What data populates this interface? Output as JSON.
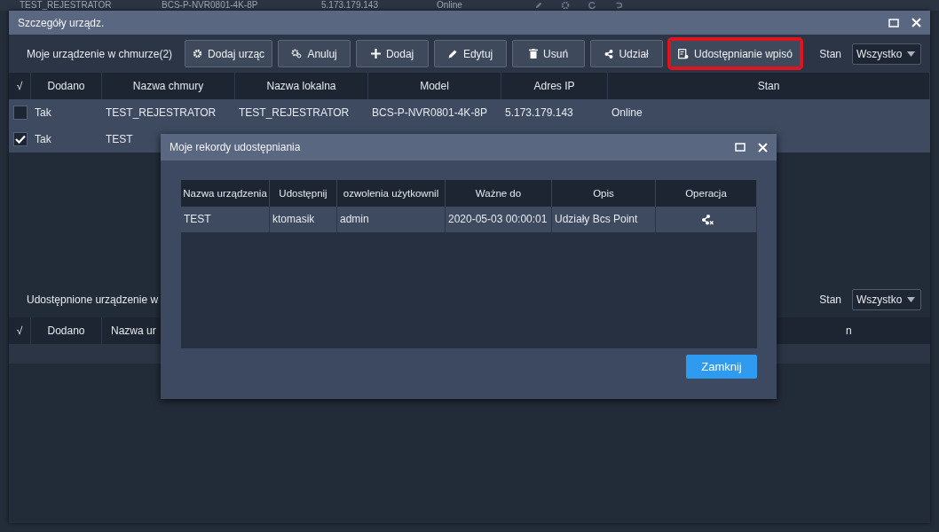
{
  "background_row": {
    "cells": [
      "TEST_REJESTRATOR",
      "BCS-P-NVR0801-4K-8P",
      "5.173.179.143",
      "Online"
    ]
  },
  "window": {
    "title": "Szczegóły urządz."
  },
  "cloud_section": {
    "label": "Moje urządzenie w chmurze(2)",
    "buttons": [
      {
        "label": "Dodaj urząc",
        "kind": "gear",
        "highlighted": false
      },
      {
        "label": "Anuluj",
        "kind": "gears",
        "highlighted": false
      },
      {
        "label": "Dodaj",
        "kind": "plus",
        "highlighted": false
      },
      {
        "label": "Edytuj",
        "kind": "pencil",
        "highlighted": false
      },
      {
        "label": "Usuń",
        "kind": "trash",
        "highlighted": false
      },
      {
        "label": "Udział",
        "kind": "share",
        "highlighted": false
      },
      {
        "label": "Udostępnianie wpisó",
        "kind": "records",
        "highlighted": true
      }
    ],
    "filter": {
      "label": "Stan",
      "value": "Wszystko"
    },
    "table": {
      "check_header": "√",
      "columns": [
        "Dodano",
        "Nazwa chmury",
        "Nazwa lokalna",
        "Model",
        "Adres IP",
        "Stan"
      ],
      "rows": [
        {
          "checked": false,
          "cells": [
            "Tak",
            "TEST_REJESTRATOR",
            "TEST_REJESTRATOR",
            "BCS-P-NVR0801-4K-8P",
            "5.173.179.143",
            "Online"
          ]
        },
        {
          "checked": true,
          "cells": [
            "Tak",
            "TEST"
          ]
        }
      ]
    }
  },
  "shared_section": {
    "label": "Udostępnione urządzenie w",
    "filter": {
      "label": "Stan",
      "value": "Wszystko"
    },
    "table": {
      "check_header": "√",
      "columns": [
        "Dodano",
        "Nazwa ur",
        "n"
      ]
    }
  },
  "dialog": {
    "title": "Moje rekordy udostępniania",
    "table": {
      "columns": [
        "Nazwa urządzenia",
        "Udostępnij",
        "ozwolenia użytkownil",
        "Ważne do",
        "Opis",
        "Operacja"
      ],
      "rows": [
        {
          "cells": [
            "TEST",
            "ktomasik",
            "admin",
            "2020-05-03 00:00:01",
            "Udziały Bcs Point"
          ]
        }
      ]
    },
    "buttons": [
      "Zamknij"
    ]
  }
}
